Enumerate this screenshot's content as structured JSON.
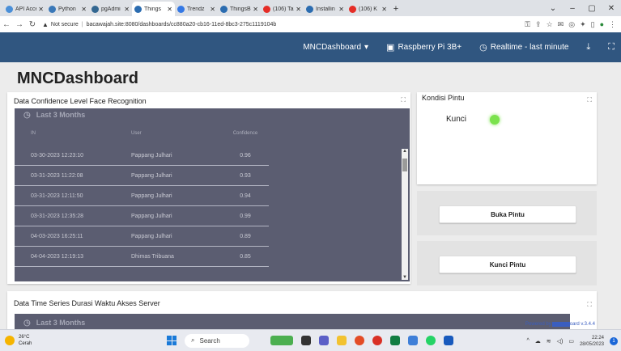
{
  "browser": {
    "tabs": [
      {
        "label": "API Acce",
        "icon": "api-icon",
        "color": "#4a8fd8",
        "active": false
      },
      {
        "label": "Python",
        "icon": "python-icon",
        "color": "#3a78b8",
        "active": false
      },
      {
        "label": "pgAdmi",
        "icon": "pgadmin-icon",
        "color": "#336791",
        "active": false
      },
      {
        "label": "Things",
        "icon": "thingsboard-icon",
        "color": "#2b6cb0",
        "active": true
      },
      {
        "label": "Trendz",
        "icon": "trendz-icon",
        "color": "#3478e5",
        "active": false
      },
      {
        "label": "ThingsB",
        "icon": "thingsboard-icon",
        "color": "#2b6cb0",
        "active": false
      },
      {
        "label": "(106) Tal",
        "icon": "youtube-icon",
        "color": "#e52d27",
        "active": false
      },
      {
        "label": "Installin",
        "icon": "thingsboard-icon",
        "color": "#2b6cb0",
        "active": false
      },
      {
        "label": "(106) K",
        "icon": "youtube-icon",
        "color": "#e52d27",
        "active": false
      }
    ],
    "new_tab": "+",
    "security_label": "Not secure",
    "url": "bacawajah.site:8080/dashboards/cc880a20-cb16-11ed-8bc3-275c1119104b"
  },
  "header": {
    "dashboard_selector": "MNCDashboard",
    "device_selector": "Raspberry Pi 3B+",
    "time_window": "Realtime - last minute"
  },
  "dashboard": {
    "title": "MNCDashboard"
  },
  "face_widget": {
    "title": "Data Confidence Level Face Recognition",
    "period": "Last 3 Months",
    "columns": [
      "IN",
      "User",
      "Confidence"
    ],
    "rows": [
      {
        "in": "03-30-2023 12:23:10",
        "user": "Pappang Julhari",
        "confidence": "0.96"
      },
      {
        "in": "03-31-2023 11:22:08",
        "user": "Pappang Julhari",
        "confidence": "0.93"
      },
      {
        "in": "03-31-2023 12:11:50",
        "user": "Pappang Julhari",
        "confidence": "0.94"
      },
      {
        "in": "03-31-2023 12:35:28",
        "user": "Pappang Julhari",
        "confidence": "0.99"
      },
      {
        "in": "04-03-2023 16:25:11",
        "user": "Pappang Julhari",
        "confidence": "0.89"
      },
      {
        "in": "04-04-2023 12:19:13",
        "user": "Dhimas Tribuana",
        "confidence": "0.85"
      }
    ]
  },
  "door_widget": {
    "title": "Kondisi Pintu",
    "lamp_label": "Kunci",
    "lamp_color": "#7be24d"
  },
  "buttons": {
    "open": "Buka Pintu",
    "lock": "Kunci Pintu"
  },
  "server_widget": {
    "title": "Data Time Series Durasi Waktu Akses Server",
    "period": "Last 3 Months"
  },
  "footer": {
    "powered_prefix": "Powered by",
    "version": "oard v.3.4.4"
  },
  "taskbar": {
    "temperature": "26°C",
    "condition": "Cerah",
    "search_placeholder": "Search",
    "time": "22:24",
    "date": "28/05/2023",
    "notifications": "1"
  },
  "colors": {
    "header_bg": "#305680",
    "panel_bg": "#5b5d71",
    "accent": "#3a5ec0"
  }
}
